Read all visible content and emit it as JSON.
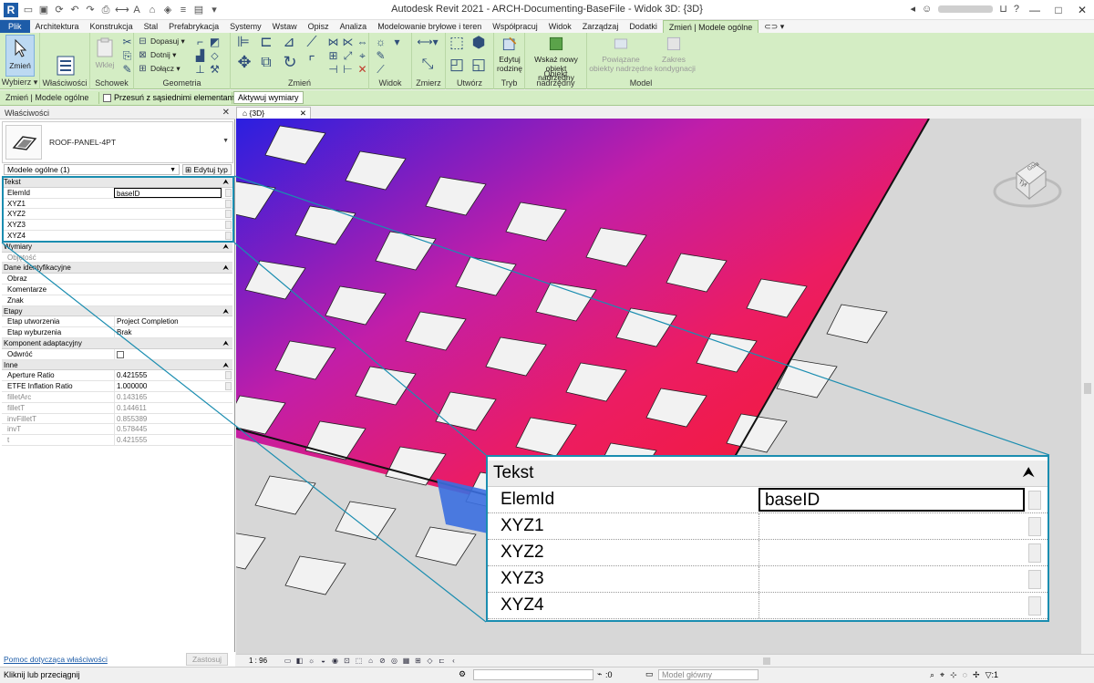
{
  "window": {
    "title": "Autodesk Revit 2021 - ARCH-Documenting-BaseFile - Widok 3D: {3D}",
    "app_logo": "R"
  },
  "ribbon_tabs": [
    "Plik",
    "Architektura",
    "Konstrukcja",
    "Stal",
    "Prefabrykacja",
    "Systemy",
    "Wstaw",
    "Opisz",
    "Analiza",
    "Modelowanie bryłowe i teren",
    "Współpracuj",
    "Widok",
    "Zarządzaj",
    "Dodatki",
    "Zmień | Modele ogólne"
  ],
  "ribbon": {
    "wybierz": {
      "btn": "Zmień",
      "label": "Wybierz ▾"
    },
    "wlasciwosci": {
      "label": "Właściwości"
    },
    "schowek": {
      "paste": "Wklej",
      "label": "Schowek"
    },
    "geometria": {
      "items": [
        "Dopasuj ▾",
        "Dotnij ▾",
        "Dołącz ▾"
      ],
      "label": "Geometria"
    },
    "zmien": {
      "label": "Zmień"
    },
    "widok": {
      "label": "Widok"
    },
    "zmierz": {
      "label": "Zmierz"
    },
    "utworz": {
      "label": "Utwórz"
    },
    "tryb": {
      "btn": "Edytuj rodzinę",
      "label": "Tryb"
    },
    "obiekt": {
      "btn": "Wskaż nowy obiekt nadrzędny",
      "label": "Obiekt nadrzędny"
    },
    "model": {
      "btn1": "Powiązane obiekty nadrzędne",
      "btn2": "Zakres kondygnacji",
      "label": "Model"
    }
  },
  "optbar": {
    "context": "Zmień | Modele ogólne",
    "checkbox": "Przesuń z sąsiednimi elementami",
    "button": "Aktywuj wymiary"
  },
  "properties": {
    "title": "Właściwości",
    "type_name": "ROOF-PANEL-4PT",
    "filter": "Modele ogólne (1)",
    "edit_type": "Edytuj typ",
    "help": "Pomoc dotycząca właściwości",
    "apply": "Zastosuj",
    "rows": [
      {
        "cat": "Tekst"
      },
      {
        "k": "ElemId",
        "v": "baseID",
        "active": true
      },
      {
        "k": "XYZ1",
        "v": ""
      },
      {
        "k": "XYZ2",
        "v": ""
      },
      {
        "k": "XYZ3",
        "v": ""
      },
      {
        "k": "XYZ4",
        "v": ""
      },
      {
        "cat": "Wymiary"
      },
      {
        "k": "Objętość",
        "v": "",
        "dim": true
      },
      {
        "cat": "Dane identyfikacyjne"
      },
      {
        "k": "Obraz",
        "v": ""
      },
      {
        "k": "Komentarze",
        "v": ""
      },
      {
        "k": "Znak",
        "v": ""
      },
      {
        "cat": "Etapy"
      },
      {
        "k": "Etap utworzenia",
        "v": "Project Completion"
      },
      {
        "k": "Etap wyburzenia",
        "v": "Brak"
      },
      {
        "cat": "Komponent adaptacyjny"
      },
      {
        "k": "Odwróć",
        "v": "",
        "checkbox": true
      },
      {
        "cat": "Inne"
      },
      {
        "k": "Aperture Ratio",
        "v": "0.421555"
      },
      {
        "k": "ETFE Inflation Ratio",
        "v": "1.000000"
      },
      {
        "k": "filletArc",
        "v": "0.143165",
        "dim": true
      },
      {
        "k": "filletT",
        "v": "0.144611",
        "dim": true
      },
      {
        "k": "invFilletT",
        "v": "0.855389",
        "dim": true
      },
      {
        "k": "invT",
        "v": "0.578445",
        "dim": true
      },
      {
        "k": "t",
        "v": "0.421555",
        "dim": true
      }
    ]
  },
  "view": {
    "tab": "{3D}",
    "scale": "1 : 96",
    "viewcube_face": "Tył",
    "viewcube_face2": "Góra"
  },
  "status": {
    "message": "Kliknij lub przeciągnij",
    "zero": ":0",
    "model": "Model główny"
  },
  "callout": {
    "cat": "Tekst",
    "rows": [
      {
        "k": "ElemId",
        "v": "baseID"
      },
      {
        "k": "XYZ1",
        "v": ""
      },
      {
        "k": "XYZ2",
        "v": ""
      },
      {
        "k": "XYZ3",
        "v": ""
      },
      {
        "k": "XYZ4",
        "v": ""
      }
    ]
  },
  "colors": {
    "accent": "#1a8db0",
    "ribbon": "#d4edc4",
    "plik": "#1d5ca8"
  }
}
